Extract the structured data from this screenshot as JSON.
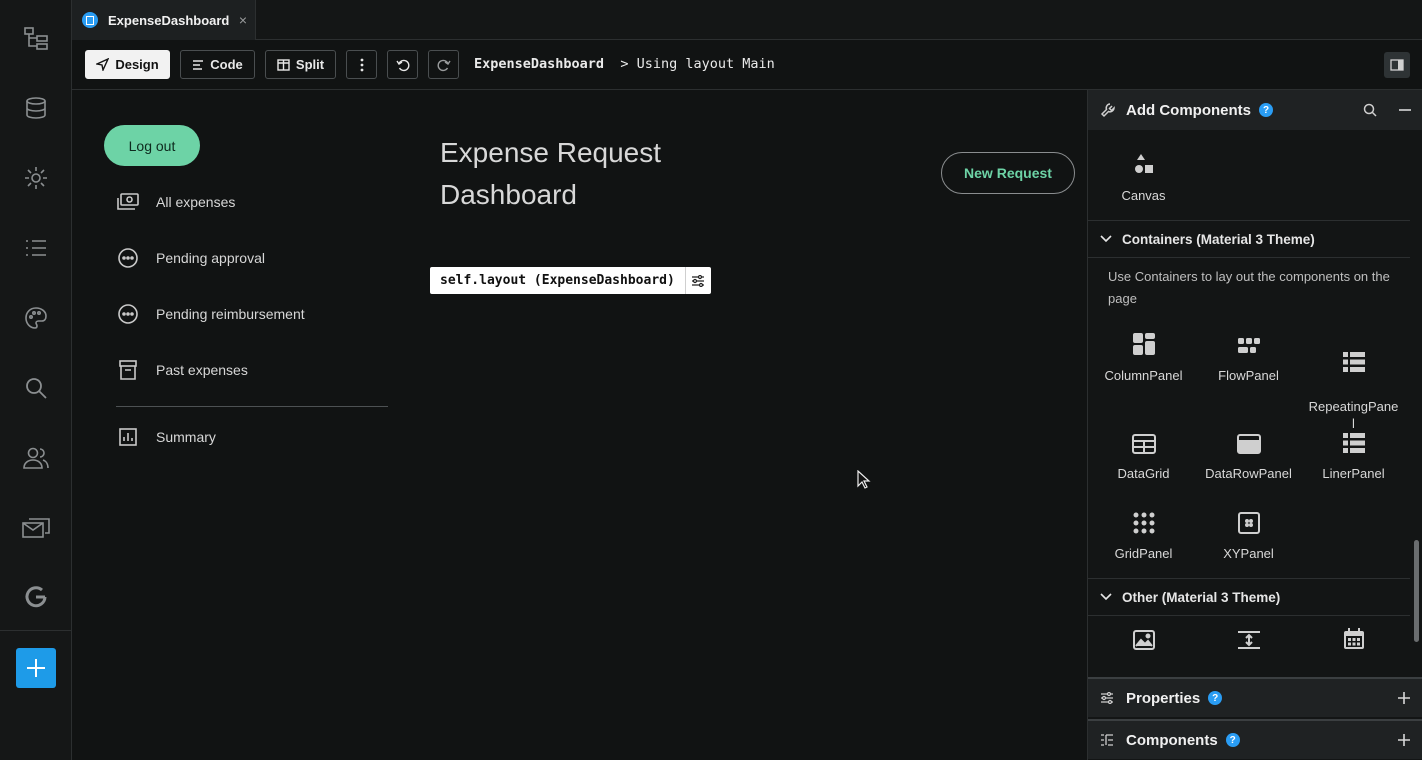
{
  "rail": {
    "items": [
      "app-tree-icon",
      "database-icon",
      "gear-icon",
      "list-icon",
      "palette-icon",
      "search-icon",
      "users-icon",
      "email-icon",
      "google-icon"
    ],
    "add_button": "plus-icon"
  },
  "tab": {
    "label": "ExpenseDashboard",
    "close": "×"
  },
  "toolbar": {
    "design": "Design",
    "code": "Code",
    "split": "Split",
    "form_name": "ExpenseDashboard",
    "separator": ">",
    "layout_text": "Using layout Main"
  },
  "canvas": {
    "logout": "Log out",
    "nav": [
      {
        "label": "All expenses",
        "icon": "money-icon"
      },
      {
        "label": "Pending approval",
        "icon": "pending-icon"
      },
      {
        "label": "Pending reimbursement",
        "icon": "pending-icon"
      },
      {
        "label": "Past expenses",
        "icon": "archive-icon"
      },
      {
        "label": "Summary",
        "icon": "chart-icon"
      }
    ],
    "title": "Expense Request Dashboard",
    "new_request": "New Request",
    "layout_tag": "self.layout (ExpenseDashboard)"
  },
  "panel": {
    "add_components": "Add Components",
    "help": "?",
    "canvas_label": "Canvas",
    "containers_title": "Containers (Material 3 Theme)",
    "containers_desc": "Use Containers to lay out the components on the page",
    "containers": [
      "ColumnPanel",
      "FlowPanel",
      "RepeatingPane\nl",
      "DataGrid",
      "DataRowPanel",
      "LinerPanel",
      "GridPanel",
      "XYPanel"
    ],
    "other_title": "Other (Material 3 Theme)",
    "properties": "Properties",
    "components": "Components"
  },
  "colors": {
    "accent": "#6dd3a6",
    "blue": "#2a9df4",
    "background": "#111313"
  }
}
